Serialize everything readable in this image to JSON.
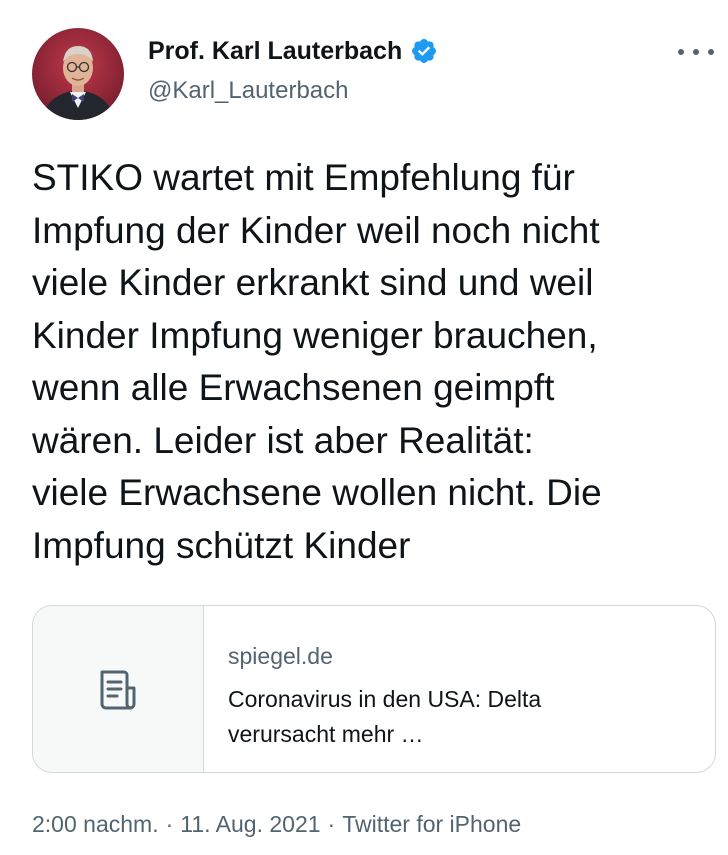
{
  "author": {
    "display_name": "Prof. Karl Lauterbach",
    "handle": "@Karl_Lauterbach",
    "verified_icon": "verified-badge-icon",
    "verified_color": "#1d9bf0"
  },
  "tweet": {
    "lines": [
      "STIKO wartet mit Empfehlung für",
      "Impfung der Kinder weil noch nicht",
      "viele Kinder erkrankt sind und weil",
      "Kinder Impfung weniger brauchen,",
      "wenn alle Erwachsenen geimpft",
      "wären. Leider ist aber Realität:",
      "viele Erwachsene wollen nicht. Die",
      "Impfung schützt Kinder"
    ]
  },
  "link_card": {
    "thumbnail_icon": "article-icon",
    "domain": "spiegel.de",
    "title_lines": [
      "Coronavirus in den USA: Delta",
      "verursacht mehr …"
    ]
  },
  "meta": {
    "time": "2:00 nachm.",
    "separator": "·",
    "date": "11. Aug. 2021",
    "source": "Twitter for iPhone"
  },
  "colors": {
    "text": "#0f1419",
    "secondary": "#536471",
    "border": "#cfd9de",
    "accent": "#1d9bf0"
  }
}
